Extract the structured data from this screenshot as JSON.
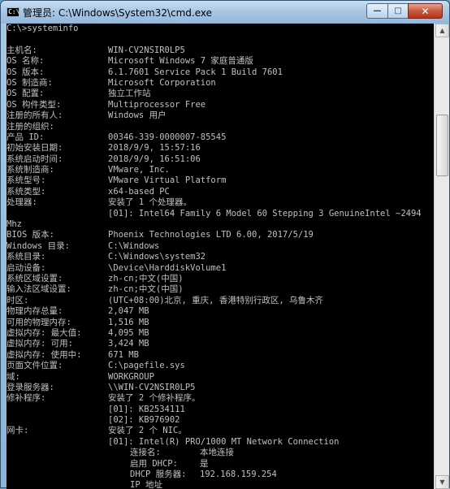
{
  "window": {
    "title": "管理员: C:\\Windows\\System32\\cmd.exe",
    "icon_text": "C:\\",
    "controls": {
      "minimize": "—",
      "maximize": "□",
      "close": "✕"
    }
  },
  "console": {
    "prompt": "C:\\>systeminfo",
    "fields": [
      {
        "label": "主机名:",
        "value": "WIN-CV2NSIR0LP5"
      },
      {
        "label": "OS 名称:",
        "value": "Microsoft Windows 7 家庭普通版"
      },
      {
        "label": "OS 版本:",
        "value": "6.1.7601 Service Pack 1 Build 7601"
      },
      {
        "label": "OS 制造商:",
        "value": "Microsoft Corporation"
      },
      {
        "label": "OS 配置:",
        "value": "独立工作站"
      },
      {
        "label": "OS 构件类型:",
        "value": "Multiprocessor Free"
      },
      {
        "label": "注册的所有人:",
        "value": "Windows 用户"
      },
      {
        "label": "注册的组织:",
        "value": ""
      },
      {
        "label": "产品 ID:",
        "value": "00346-339-0000007-85545"
      },
      {
        "label": "初始安装日期:",
        "value": "2018/9/9, 15:57:16"
      },
      {
        "label": "系统启动时间:",
        "value": "2018/9/9, 16:51:06"
      },
      {
        "label": "系统制造商:",
        "value": "VMware, Inc."
      },
      {
        "label": "系统型号:",
        "value": "VMware Virtual Platform"
      },
      {
        "label": "系统类型:",
        "value": "x64-based PC"
      },
      {
        "label": "处理器:",
        "value": "安装了 1 个处理器。"
      }
    ],
    "processor_detail": "[01]: Intel64 Family 6 Model 60 Stepping 3 GenuineIntel ~2494",
    "processor_wrap": "Mhz",
    "fields2": [
      {
        "label": "BIOS 版本:",
        "value": "Phoenix Technologies LTD 6.00, 2017/5/19"
      },
      {
        "label": "Windows 目录:",
        "value": "C:\\Windows"
      },
      {
        "label": "系统目录:",
        "value": "C:\\Windows\\system32"
      },
      {
        "label": "启动设备:",
        "value": "\\Device\\HarddiskVolume1"
      },
      {
        "label": "系统区域设置:",
        "value": "zh-cn;中文(中国)"
      },
      {
        "label": "输入法区域设置:",
        "value": "zh-cn;中文(中国)"
      },
      {
        "label": "时区:",
        "value": "(UTC+08:00)北京, 重庆, 香港特别行政区, 乌鲁木齐"
      },
      {
        "label": "物理内存总量:",
        "value": "2,047 MB"
      },
      {
        "label": "可用的物理内存:",
        "value": "1,516 MB"
      },
      {
        "label": "虚拟内存: 最大值:",
        "value": "4,095 MB"
      },
      {
        "label": "虚拟内存: 可用:",
        "value": "3,424 MB"
      },
      {
        "label": "虚拟内存: 使用中:",
        "value": "671 MB"
      },
      {
        "label": "页面文件位置:",
        "value": "C:\\pagefile.sys"
      },
      {
        "label": "域:",
        "value": "WORKGROUP"
      },
      {
        "label": "登录服务器:",
        "value": "\\\\WIN-CV2NSIR0LP5"
      },
      {
        "label": "修补程序:",
        "value": "安装了 2 个修补程序。"
      }
    ],
    "hotfixes": [
      "[01]: KB2534111",
      "[02]: KB976902"
    ],
    "nic_label": "网卡:",
    "nic_value": "安装了 2 个 NIC。",
    "nic_adapter": "[01]: Intel(R) PRO/1000 MT Network Connection",
    "nic_details": [
      {
        "label": "连接名:",
        "value": "本地连接"
      },
      {
        "label": "启用 DHCP:",
        "value": "是"
      },
      {
        "label": "DHCP 服务器:",
        "value": "192.168.159.254"
      },
      {
        "label": "IP 地址",
        "value": ""
      }
    ]
  },
  "scrollbar": {
    "up_arrow": "▲",
    "down_arrow": "▼"
  }
}
